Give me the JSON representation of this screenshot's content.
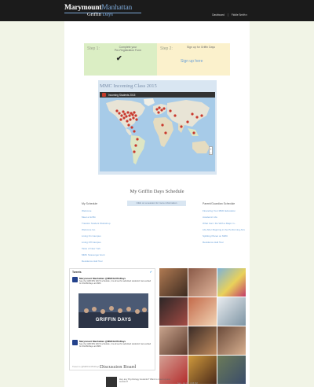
{
  "header": {
    "logo_main": "Marymount",
    "logo_accent": "Manhattan",
    "logo_sub": "Griffin",
    "logo_sub_accent": "Days",
    "nav": [
      "Dashboard",
      "Fiddle Smith ▾"
    ]
  },
  "steps": {
    "step1_label": "Step 1:",
    "step1_desc": "Complete your\nPre-Registration Form",
    "step1_status": "✔",
    "step2_label": "Step 2:",
    "step2_desc": "Sign up for Griffin Days",
    "step2_link": "Sign up here"
  },
  "map": {
    "title": "MMC Incoming Class 2015",
    "bar_title": "Incoming Students 2015"
  },
  "schedule": {
    "title": "My Griffin Days Schedule",
    "click_hint": "Click on a session for more information",
    "left_header": "My Schedule",
    "left_items": [
      "Welcome",
      "Meet a Griffin",
      "Transfer Student Workshop",
      "Welcome Go",
      "Living On Campus",
      "Living Off Campus",
      "Taste of New York",
      "MMC Scavenger Hunt",
      "Residence Hall Tour"
    ],
    "right_header": "Parent/Guardian Schedule",
    "right_items": [
      "Financing Your MMC Education",
      "Academic Life",
      "What Can I Do With a Major in...",
      "Life After Majoring in the Performing Arts",
      "Splitting Planet on MMC",
      "Residence Hall Tour"
    ]
  },
  "tweets": {
    "header": "Tweets",
    "items": [
      {
        "name": "Marymount Manhattan @MMCGriffinDays",
        "text": "See the GRIFFIN DAYS schedule, it is all set for admitted students! Get excited for #GriffinDays at MMC"
      },
      {
        "name": "Marymount Manhattan @MMCGriffinDays",
        "text": "See the GRIFFIN DAYS schedule, it is all set for admitted students! Get excited for #GriffinDays at MMC"
      }
    ],
    "image_text": "GRIFFIN DAYS",
    "footer": "Tweet to @MMCGriffinDays"
  },
  "discussion": {
    "title": "Discussion Board",
    "post_text": "Hey any Psychology students? Want to meet up at a session?",
    "post_meta": "Sep  ·  Jul 15  ·  3:05 PM"
  }
}
